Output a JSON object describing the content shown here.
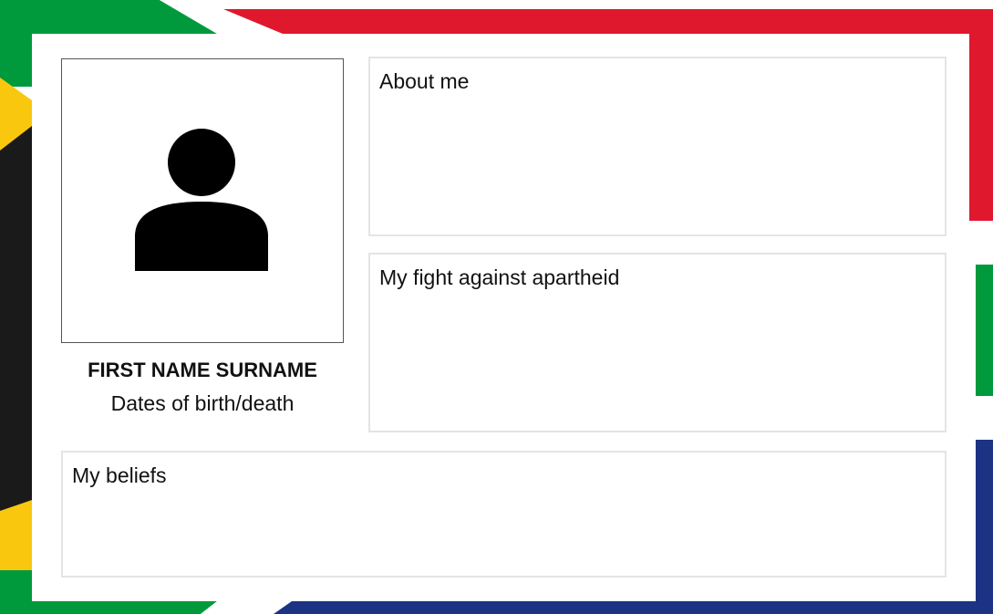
{
  "profile": {
    "name": "FIRST NAME SURNAME",
    "dates": "Dates of birth/death",
    "photo_icon": "person-icon"
  },
  "sections": {
    "about": "About me",
    "fight": "My fight against apartheid",
    "beliefs": "My beliefs"
  },
  "colors": {
    "green": "#009a3d",
    "gold": "#f9c80e",
    "black": "#1a1a1a",
    "red": "#e0182e",
    "blue": "#1c3384",
    "white": "#ffffff"
  }
}
